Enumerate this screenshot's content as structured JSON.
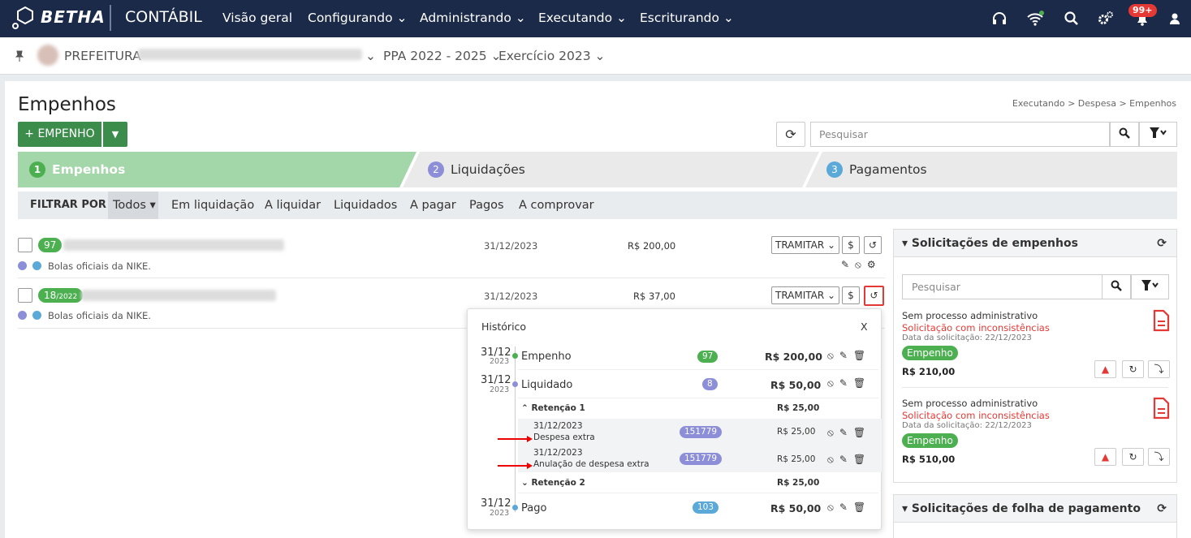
{
  "app": {
    "brand": "BETHA",
    "name": "CONTÁBIL",
    "notifications": "99+"
  },
  "nav": [
    "Visão geral",
    "Configurando",
    "Administrando",
    "Executando",
    "Escriturando"
  ],
  "context": {
    "entity": "PREFEITURA",
    "ppa": "PPA 2022 - 2025",
    "exercicio": "Exercício 2023"
  },
  "page": {
    "title": "Empenhos",
    "breadcrumb": "Executando > Despesa > Empenhos",
    "new_button": "+ EMPENHO",
    "search_placeholder": "Pesquisar"
  },
  "steps": [
    {
      "num": "1",
      "label": "Empenhos"
    },
    {
      "num": "2",
      "label": "Liquidações"
    },
    {
      "num": "3",
      "label": "Pagamentos"
    }
  ],
  "filters": {
    "label": "FILTRAR POR",
    "items": [
      "Todos",
      "Em liquidação",
      "A liquidar",
      "Liquidados",
      "A pagar",
      "Pagos",
      "A comprovar"
    ]
  },
  "rows": [
    {
      "badge": "97",
      "date": "31/12/2023",
      "value": "R$ 200,00",
      "desc": "Bolas oficiais da NIKE.",
      "action": "TRAMITAR"
    },
    {
      "badge": "18",
      "badge_sub": "/2022",
      "date": "31/12/2023",
      "value": "R$ 37,00",
      "desc": "Bolas oficiais da NIKE.",
      "action": "TRAMITAR"
    }
  ],
  "history": {
    "title": "Histórico",
    "close": "X",
    "items": [
      {
        "day": "31/12",
        "year": "2023",
        "label": "Empenho",
        "badge": "97",
        "value": "R$ 200,00"
      },
      {
        "day": "31/12",
        "year": "2023",
        "label": "Liquidado",
        "badge": "8",
        "value": "R$ 50,00"
      },
      {
        "day": "31/12",
        "year": "2023",
        "label": "Pago",
        "badge": "103",
        "value": "R$ 50,00"
      }
    ],
    "ret1": {
      "label": "Retenção 1",
      "value": "R$ 25,00"
    },
    "ret1_items": [
      {
        "date": "31/12/2023",
        "label": "Despesa extra",
        "badge": "151779",
        "value": "R$ 25,00"
      },
      {
        "date": "31/12/2023",
        "label": "Anulação de despesa extra",
        "badge": "151779",
        "value": "R$ 25,00"
      }
    ],
    "ret2": {
      "label": "Retenção 2",
      "value": "R$ 25,00"
    }
  },
  "panel1": {
    "title": "Solicitações de empenhos",
    "search_placeholder": "Pesquisar",
    "items": [
      {
        "line1": "Sem processo administrativo",
        "line2": "Solicitação com inconsistências",
        "line3": "Data da solicitação: 22/12/2023",
        "tag": "Empenho",
        "value": "R$ 210,00"
      },
      {
        "line1": "Sem processo administrativo",
        "line2": "Solicitação com inconsistências",
        "line3": "Data da solicitação: 22/12/2023",
        "tag": "Empenho",
        "value": "R$ 510,00"
      }
    ]
  },
  "panel2": {
    "title": "Solicitações de folha de pagamento"
  },
  "colors": {
    "topbar": "#1b2a48",
    "green": "#3c8d4c",
    "step_active": "#a3d6a8",
    "badge_green": "#4caf50",
    "lilac": "#8c8fd8",
    "blue": "#5aa9d8",
    "red": "#e53935"
  }
}
